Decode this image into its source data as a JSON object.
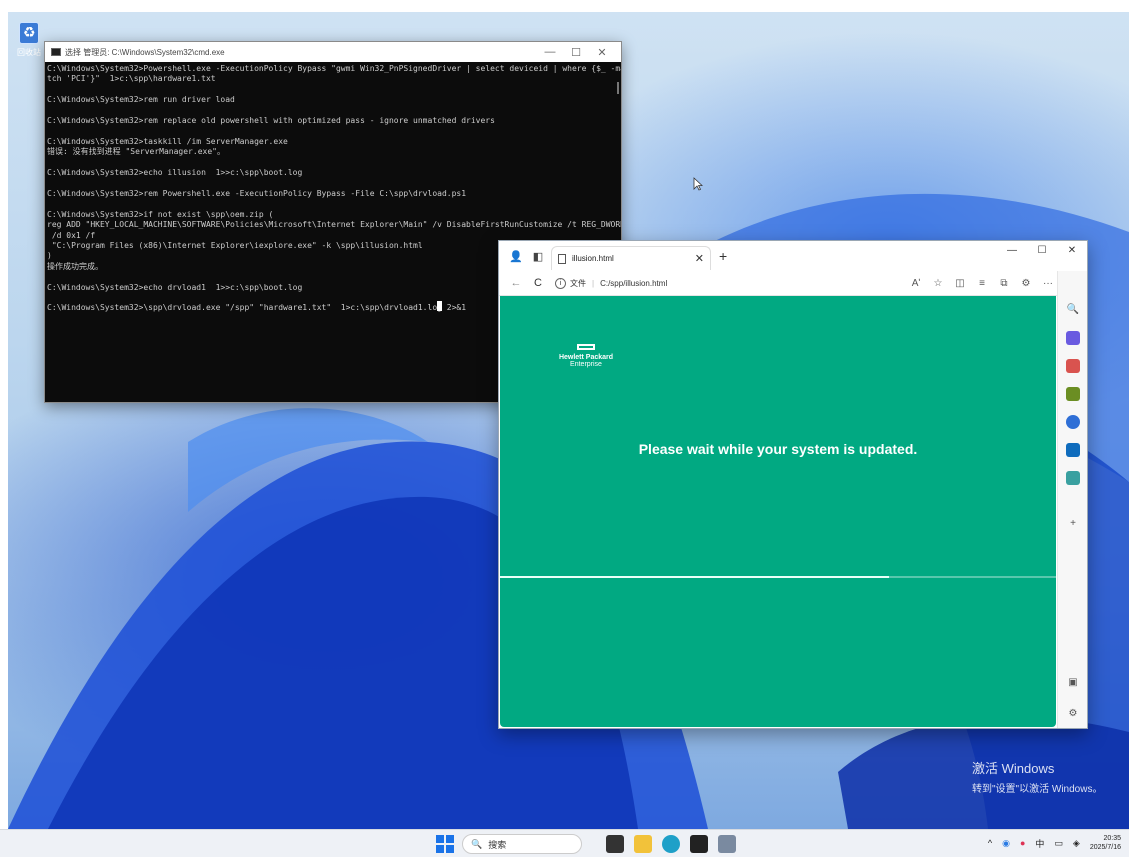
{
  "desktop": {
    "recycle_bin_label": "回收站",
    "activation_line1": "激活 Windows",
    "activation_line2": "转到\"设置\"以激活 Windows。"
  },
  "cmd": {
    "title": "选择 管理员: C:\\Windows\\System32\\cmd.exe",
    "controls": {
      "minimize": "—",
      "maximize": "☐",
      "close": "✕"
    },
    "lines": [
      "C:\\Windows\\System32>Powershell.exe -ExecutionPolicy Bypass \"gwmi Win32_PnPSignedDriver | select deviceid | where {$_ -ma",
      "tch 'PCI'}\"  1>c:\\spp\\hardware1.txt",
      "",
      "C:\\Windows\\System32>rem run driver load",
      "",
      "C:\\Windows\\System32>rem replace old powershell with optimized pass - ignore unmatched drivers",
      "",
      "C:\\Windows\\System32>taskkill /im ServerManager.exe",
      "错误: 没有找到进程 \"ServerManager.exe\"。",
      "",
      "C:\\Windows\\System32>echo illusion  1>>c:\\spp\\boot.log",
      "",
      "C:\\Windows\\System32>rem Powershell.exe -ExecutionPolicy Bypass -File C:\\spp\\drvload.ps1",
      "",
      "C:\\Windows\\System32>if not exist \\spp\\oem.zip (",
      "reg ADD \"HKEY_LOCAL_MACHINE\\SOFTWARE\\Policies\\Microsoft\\Internet Explorer\\Main\" /v DisableFirstRunCustomize /t REG_DWORD",
      " /d 0x1 /f",
      " \"C:\\Program Files (x86)\\Internet Explorer\\iexplore.exe\" -k \\spp\\illusion.html",
      ")",
      "操作成功完成。",
      "",
      "C:\\Windows\\System32>echo drvload1  1>>c:\\spp\\boot.log",
      "",
      "C:\\Windows\\System32>\\spp\\drvload.exe \"/spp\" \"hardware1.txt\"  1>c:\\spp\\drvload1.log 2>&1"
    ]
  },
  "browser": {
    "tab_title": "illusion.html",
    "tab_close": "✕",
    "new_tab": "+",
    "controls": {
      "minimize": "—",
      "maximize": "☐",
      "close": "✕"
    },
    "address_label": "文件",
    "url": "C:/spp/illusion.html",
    "read_aloud": "Aʹ",
    "more": "···",
    "page": {
      "logo_line1": "Hewlett Packard",
      "logo_line2": "Enterprise",
      "message": "Please wait while your system is updated.",
      "progress_percent": 70
    },
    "sidebar_add": "+",
    "colors": {
      "page_bg": "#01a982"
    }
  },
  "taskbar": {
    "search_placeholder": "搜索",
    "tray_ime": "中",
    "time": "20:35",
    "date": "2025/7/16"
  }
}
